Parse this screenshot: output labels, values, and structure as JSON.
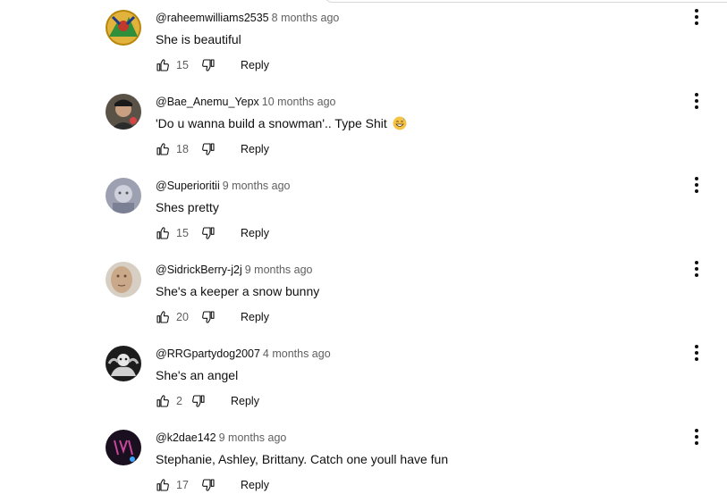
{
  "comments": [
    {
      "handle": "@raheemwilliams2535",
      "time": "8 months ago",
      "text": "She is beautiful",
      "likes": "15",
      "reply_label": "Reply",
      "avatar_icon": "avatar-raheemwilliams2535"
    },
    {
      "handle": "@Bae_Anemu_Yepx",
      "time": "10 months ago",
      "text": "'Do u wanna build a snowman'.. Type Shit",
      "emoji": "grinning-sweat-emoji",
      "likes": "18",
      "reply_label": "Reply",
      "avatar_icon": "avatar-bae-anemu-yepx"
    },
    {
      "handle": "@Superioritii",
      "time": "9 months ago",
      "text": "Shes pretty",
      "likes": "15",
      "reply_label": "Reply",
      "avatar_icon": "avatar-superioritii"
    },
    {
      "handle": "@SidrickBerry-j2j",
      "time": "9 months ago",
      "text": "She's a keeper a snow bunny",
      "likes": "20",
      "reply_label": "Reply",
      "avatar_icon": "avatar-sidrickberry"
    },
    {
      "handle": "@RRGpartydog2007",
      "time": "4 months ago",
      "text": "She's an angel",
      "likes": "2",
      "reply_label": "Reply",
      "avatar_icon": "avatar-rrgpartydog2007"
    },
    {
      "handle": "@k2dae142",
      "time": "9 months ago",
      "text": "Stephanie, Ashley, Brittany. Catch one youll have fun",
      "likes": "17",
      "reply_label": "Reply",
      "avatar_icon": "avatar-k2dae142"
    }
  ],
  "colors": {
    "text_primary": "#0f0f0f",
    "text_secondary": "#606060",
    "background": "#ffffff"
  }
}
